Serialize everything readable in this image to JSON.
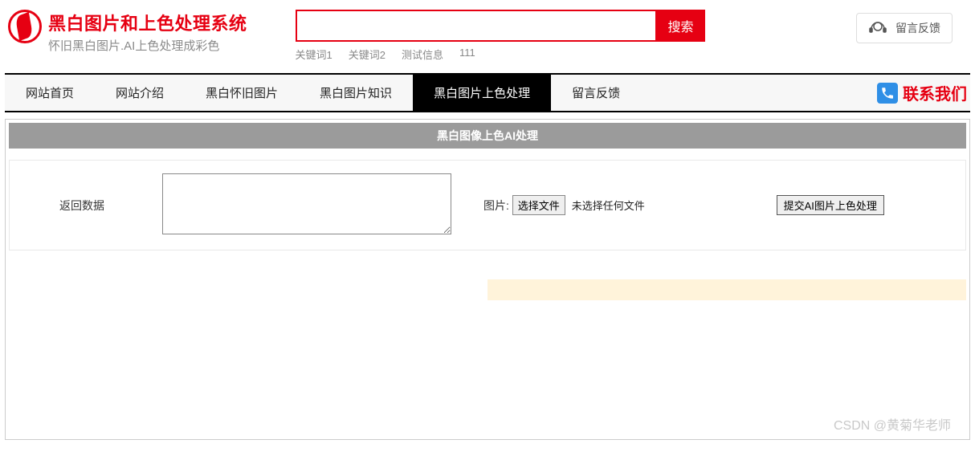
{
  "header": {
    "site_title": "黑白图片和上色处理系统",
    "site_subtitle": "怀旧黑白图片.AI上色处理成彩色"
  },
  "search": {
    "value": "",
    "button": "搜索",
    "keywords": [
      "关键词1",
      "关键词2",
      "测试信息",
      "111"
    ]
  },
  "feedback_top": {
    "label": "留言反馈"
  },
  "nav": {
    "items": [
      {
        "label": "网站首页",
        "active": false
      },
      {
        "label": "网站介绍",
        "active": false
      },
      {
        "label": "黑白怀旧图片",
        "active": false
      },
      {
        "label": "黑白图片知识",
        "active": false
      },
      {
        "label": "黑白图片上色处理",
        "active": true
      },
      {
        "label": "留言反馈",
        "active": false
      }
    ],
    "contact": "联系我们"
  },
  "main": {
    "panel_title": "黑白图像上色AI处理",
    "return_data_label": "返回数据",
    "file_label": "图片:",
    "file_button": "选择文件",
    "file_status": "未选择任何文件",
    "submit_button": "提交AI图片上色处理",
    "textarea_value": ""
  },
  "watermark": "CSDN @黄菊华老师"
}
